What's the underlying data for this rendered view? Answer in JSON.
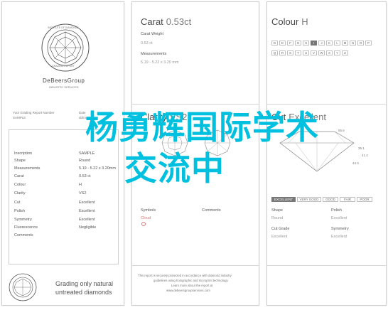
{
  "left": {
    "seal_top_text": "INSTITUTE OF DIAMONDS",
    "seal_bottom_text": "GRADING REPORT",
    "brand": "DeBeersGroup",
    "brand_sub": "INDUSTRY SERVICES",
    "report_label": "Your Grading Report Number",
    "report_number": "SAMPLE",
    "date_label": "Date",
    "date_value": "dd/mm/yy",
    "rows": [
      {
        "label": "Inscription",
        "value": "SAMPLE"
      },
      {
        "label": "Shape",
        "value": "Round"
      },
      {
        "label": "Measurements",
        "value": "5.19 - 5.22 x 3.20mm"
      },
      {
        "label": "Carat",
        "value": "0.53 ct"
      },
      {
        "label": "Colour",
        "value": "H"
      },
      {
        "label": "Clarity",
        "value": "VS2"
      },
      {
        "label": "Cut",
        "value": "Excellent"
      },
      {
        "label": "Polish",
        "value": "Excellent"
      },
      {
        "label": "Symmetry",
        "value": "Excellent"
      },
      {
        "label": "Fluorescence",
        "value": "Negligible"
      },
      {
        "label": "Comments",
        "value": ""
      }
    ],
    "bottom_text_line1": "Grading only natural",
    "bottom_text_line2": "untreated diamonds"
  },
  "mid": {
    "title_word": "Carat",
    "title_value": "0.53ct",
    "carat_weight_label": "Carat Weight",
    "carat_weight_value": "0.53 ct",
    "measurements_label": "Measurements",
    "measurements_value": "5.19 - 5.22 x 3.20 mm",
    "clarity_word": "Clarity",
    "clarity_value": "VS2",
    "symbols_label": "Symbols",
    "symbols_value": "Cloud",
    "comments_label": "Comments",
    "footer_lines": [
      "This report is securely protected in accordance with diamond industry",
      "guidelines using holographic and microprint technology.",
      "Learn more about the report at",
      "www.debeersgroupservices.com"
    ]
  },
  "right": {
    "title_word": "Colour",
    "title_value": "H",
    "colour_scale_1": [
      "D",
      "E",
      "F",
      "G",
      "H",
      "I",
      "J",
      "K"
    ],
    "colour_scale_2": [
      "L",
      "M",
      "N",
      "O",
      "P",
      "Q",
      "R",
      "S"
    ],
    "colour_scale_2b": [
      "T",
      "U",
      "V",
      "W",
      "X",
      "Y",
      "Z"
    ],
    "colour_selected": "H",
    "cut_word": "Cut",
    "cut_value": "Excellent",
    "proportion_labels": [
      "55.6",
      "35.1",
      "41.4",
      "44.3"
    ],
    "cut_scale": [
      "EXCELLENT",
      "VERY GOOD",
      "GOOD",
      "FAIR",
      "POOR"
    ],
    "cut_selected": "EXCELLENT",
    "shape_label": "Shape",
    "shape_value": "Round",
    "polish_label": "Polish",
    "polish_value": "Excellent",
    "cut_grade_label": "Cut Grade",
    "cut_grade_value": "Excellent",
    "symmetry_label": "Symmetry",
    "symmetry_value": "Excellent"
  },
  "overlay": {
    "line1": "杨勇辉国际学术",
    "line2": "交流中"
  }
}
